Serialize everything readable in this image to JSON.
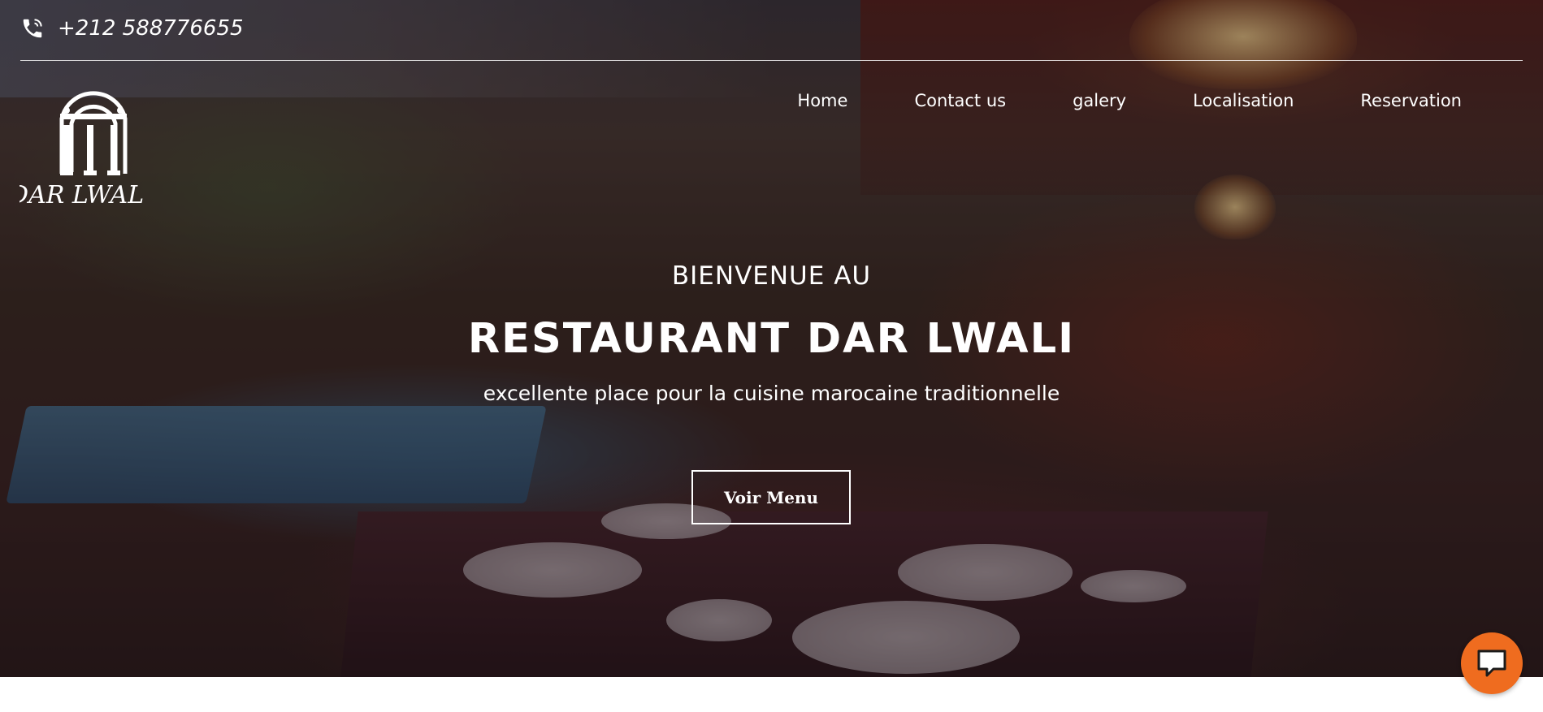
{
  "header": {
    "phone_icon": "phone-icon",
    "phone_number": "+212 588776655"
  },
  "logo": {
    "text": "DAR LWALI"
  },
  "nav": {
    "items": [
      {
        "label": "Home"
      },
      {
        "label": "Contact us"
      },
      {
        "label": "galery"
      },
      {
        "label": "Localisation"
      },
      {
        "label": "Reservation"
      }
    ]
  },
  "hero": {
    "welcome": "BIENVENUE AU",
    "title": "RESTAURANT DAR LWALI",
    "subtitle": "excellente place pour la cuisine marocaine traditionnelle",
    "button_label": "Voir Menu"
  },
  "chat": {
    "icon": "chat-icon"
  },
  "colors": {
    "chat_button": "#ef6c1f",
    "text": "#ffffff"
  }
}
